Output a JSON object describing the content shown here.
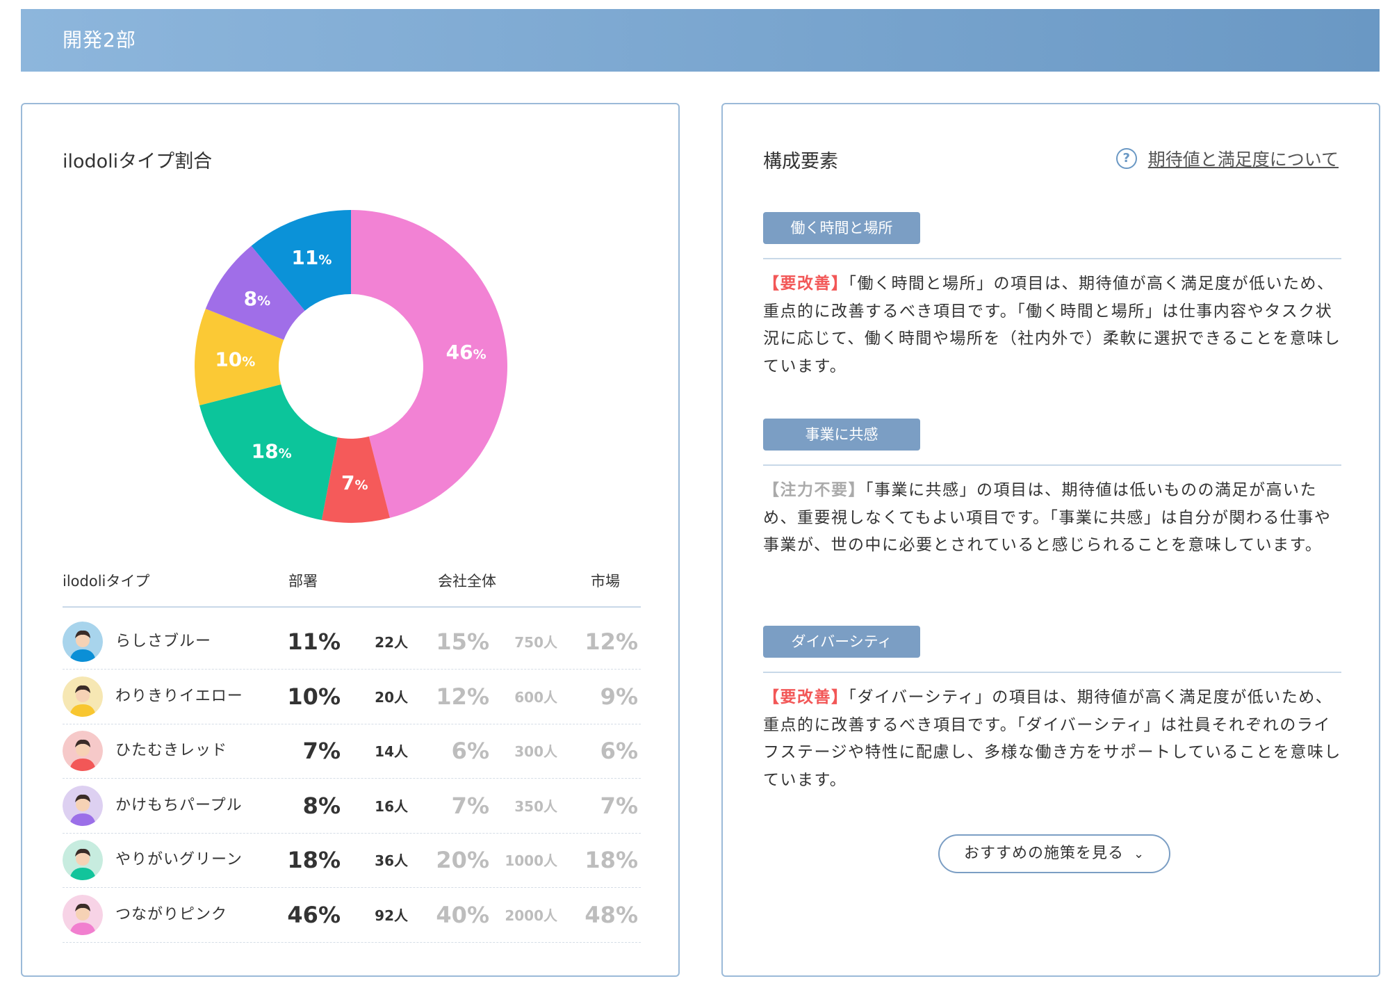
{
  "header": {
    "title": "開発2部"
  },
  "left_card": {
    "title": "ilodoliタイプ割合",
    "table_headers": {
      "type": "ilodoliタイプ",
      "dept": "部署",
      "company": "会社全体",
      "market": "市場"
    },
    "rows": [
      {
        "name": "らしさブルー",
        "dept_pct": "11%",
        "dept_count": "22人",
        "company_pct": "15%",
        "company_count": "750人",
        "market_pct": "12%",
        "avatar_color": "#a8d4ec",
        "shirt": "#0b8fd6",
        "icon": "blue-cap-avatar-icon"
      },
      {
        "name": "わりきりイエロー",
        "dept_pct": "10%",
        "dept_count": "20人",
        "company_pct": "12%",
        "company_count": "600人",
        "market_pct": "9%",
        "avatar_color": "#f6e7b3",
        "shirt": "#f8c630",
        "icon": "yellow-avatar-icon"
      },
      {
        "name": "ひたむきレッド",
        "dept_pct": "7%",
        "dept_count": "14人",
        "company_pct": "6%",
        "company_count": "300人",
        "market_pct": "6%",
        "avatar_color": "#f6c9c9",
        "shirt": "#f25757",
        "icon": "red-avatar-icon"
      },
      {
        "name": "かけもちパープル",
        "dept_pct": "8%",
        "dept_count": "16人",
        "company_pct": "7%",
        "company_count": "350人",
        "market_pct": "7%",
        "avatar_color": "#ddd0f1",
        "shirt": "#9b6fe8",
        "icon": "purple-avatar-icon"
      },
      {
        "name": "やりがいグリーン",
        "dept_pct": "18%",
        "dept_count": "36人",
        "company_pct": "20%",
        "company_count": "1000人",
        "market_pct": "18%",
        "avatar_color": "#c7ecdf",
        "shirt": "#12c49b",
        "icon": "green-avatar-icon"
      },
      {
        "name": "つながりピンク",
        "dept_pct": "46%",
        "dept_count": "92人",
        "company_pct": "40%",
        "company_count": "2000人",
        "market_pct": "48%",
        "avatar_color": "#f7d3e6",
        "shirt": "#f17fcf",
        "icon": "pink-avatar-icon"
      }
    ]
  },
  "chart_data": {
    "type": "pie",
    "categories": [
      "つながりピンク",
      "ひたむきレッド",
      "やりがいグリーン",
      "わりきりイエロー",
      "かけもちパープル",
      "らしさブルー"
    ],
    "values": [
      46,
      7,
      18,
      10,
      8,
      11
    ],
    "labels": [
      "46",
      "7",
      "18",
      "10",
      "8",
      "11"
    ],
    "unit": "%",
    "colors": [
      "#f282d4",
      "#f55a5a",
      "#0cc59b",
      "#fbc935",
      "#a06ee8",
      "#0b92d8"
    ]
  },
  "right_card": {
    "title": "構成要素",
    "help_link": "期待値と満足度について",
    "sections": [
      {
        "tag": "働く時間と場所",
        "mark": "【要改善】",
        "mark_type": "red",
        "body": "「働く時間と場所」の項目は、期待値が高く満足度が低いため、重点的に改善するべき項目です。「働く時間と場所」は仕事内容やタスク状況に応じて、働く時間や場所を（社内外で）柔軟に選択できることを意味しています。"
      },
      {
        "tag": "事業に共感",
        "mark": "【注力不要】",
        "mark_type": "gray",
        "body": "「事業に共感」の項目は、期待値は低いものの満足が高いため、重要視しなくてもよい項目です。「事業に共感」は自分が関わる仕事や事業が、世の中に必要とされていると感じられることを意味しています。"
      },
      {
        "tag": "ダイバーシティ",
        "mark": "【要改善】",
        "mark_type": "red",
        "body": "「ダイバーシティ」の項目は、期待値が高く満足度が低いため、重点的に改善するべき項目です。「ダイバーシティ」は社員それぞれのライフステージや特性に配慮し、多様な働き方をサポートしていることを意味しています。"
      }
    ],
    "recommend_button": "おすすめの施策を見る"
  }
}
